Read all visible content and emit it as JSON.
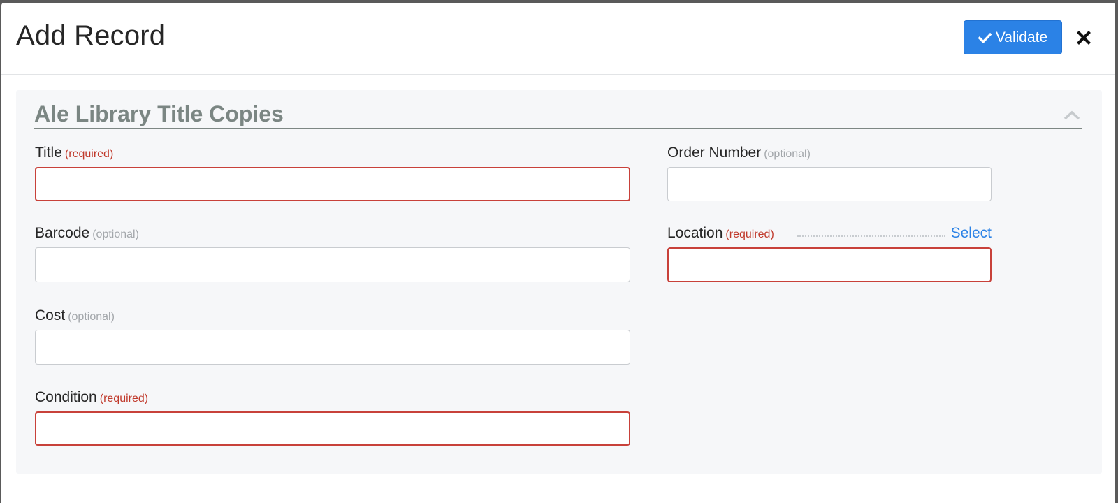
{
  "modal": {
    "title": "Add Record",
    "validate_label": "Validate"
  },
  "section": {
    "title": "Ale Library Title Copies"
  },
  "fields": {
    "title": {
      "label": "Title",
      "tag": "(required)",
      "value": ""
    },
    "barcode": {
      "label": "Barcode",
      "tag": "(optional)",
      "value": ""
    },
    "cost": {
      "label": "Cost",
      "tag": "(optional)",
      "value": ""
    },
    "condition": {
      "label": "Condition",
      "tag": "(required)",
      "value": ""
    },
    "order_number": {
      "label": "Order Number",
      "tag": "(optional)",
      "value": ""
    },
    "location": {
      "label": "Location",
      "tag": "(required)",
      "value": "",
      "select_label": "Select"
    }
  },
  "icons": {
    "validate": "check-icon",
    "close": "close-icon",
    "collapse": "chevron-up-icon"
  },
  "colors": {
    "primary": "#2b82e6",
    "required": "#c0392b",
    "optional": "#a3a7ab",
    "section_title": "#7b8683"
  }
}
